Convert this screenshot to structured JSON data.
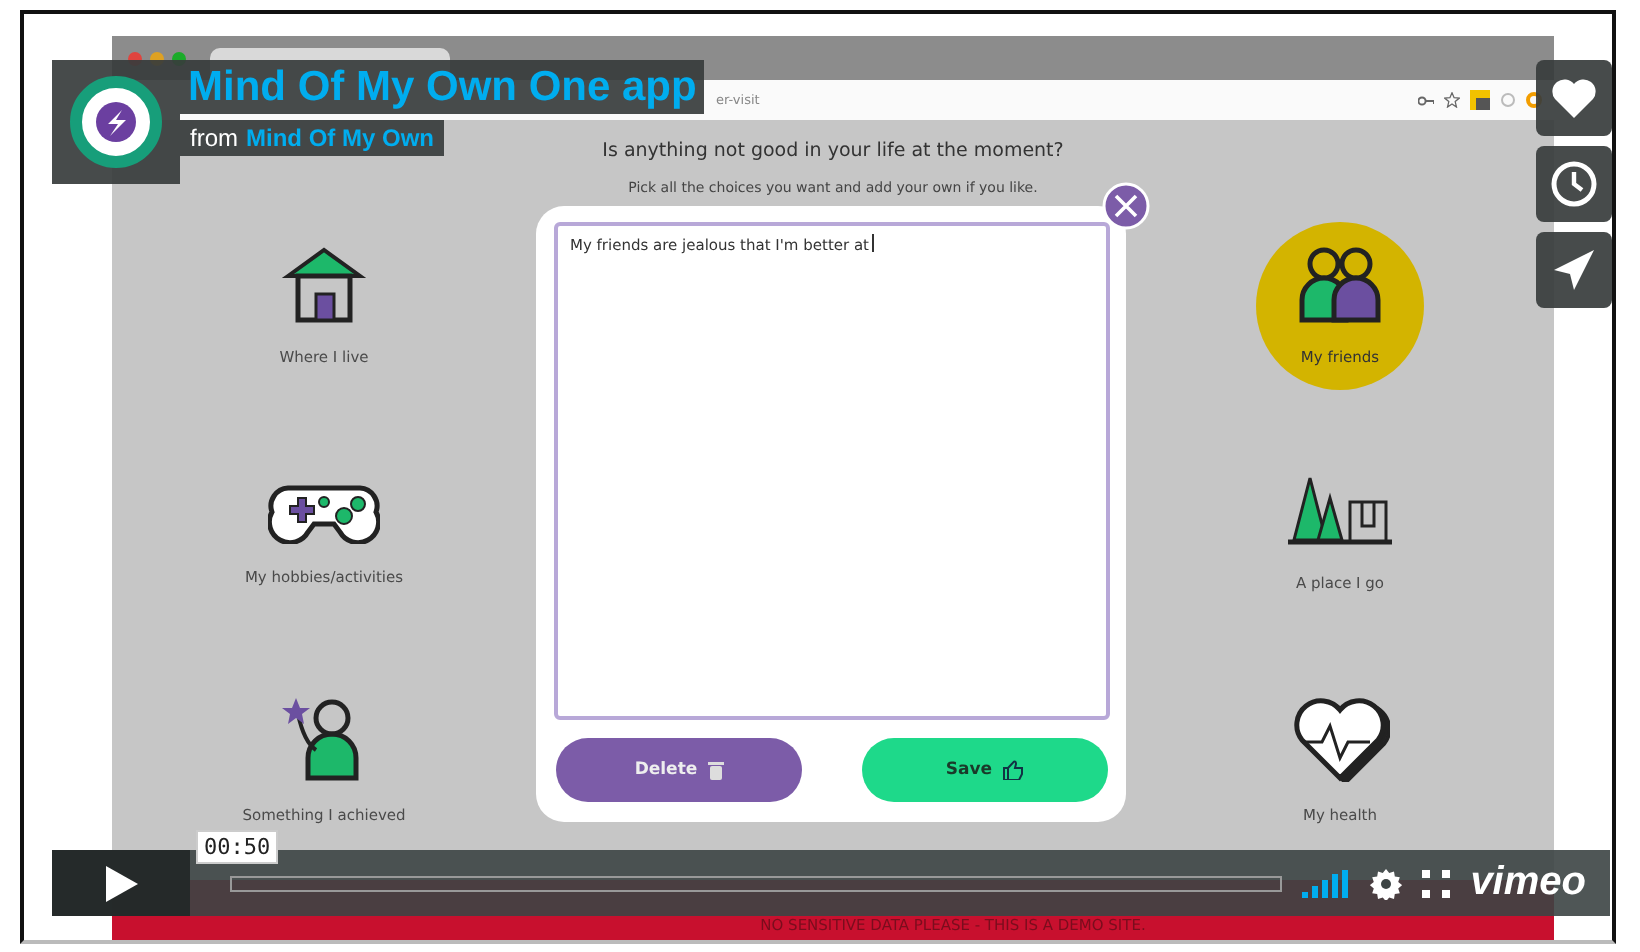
{
  "video": {
    "browser": {
      "url": "er-visit"
    },
    "page": {
      "heading": "Is anything not good in your life at the moment?",
      "subheading": "Pick all the choices you want and add your own if you like.",
      "left_options": [
        {
          "label": "Where I live",
          "kind": "house",
          "selected": false
        },
        {
          "label": "My hobbies/activities",
          "kind": "controller",
          "selected": false
        },
        {
          "label": "Something I achieved",
          "kind": "achiever",
          "selected": false
        }
      ],
      "right_options": [
        {
          "label": "My friends",
          "kind": "friends",
          "selected": true
        },
        {
          "label": "A place I go",
          "kind": "park",
          "selected": false
        },
        {
          "label": "My health",
          "kind": "health",
          "selected": false
        }
      ],
      "dialog": {
        "text": "My friends are jealous that I'm better at",
        "buttons": [
          {
            "label": "Delete",
            "kind": "delete"
          },
          {
            "label": "Save",
            "kind": "save"
          }
        ]
      },
      "banner": "NO SENSITIVE DATA PLEASE - THIS IS A DEMO SITE."
    }
  },
  "overlay": {
    "title": "Mind Of My Own One app",
    "byline_prefix": "from",
    "author": "Mind Of My Own"
  },
  "player": {
    "time": "00:50",
    "logo": "vimeo"
  }
}
